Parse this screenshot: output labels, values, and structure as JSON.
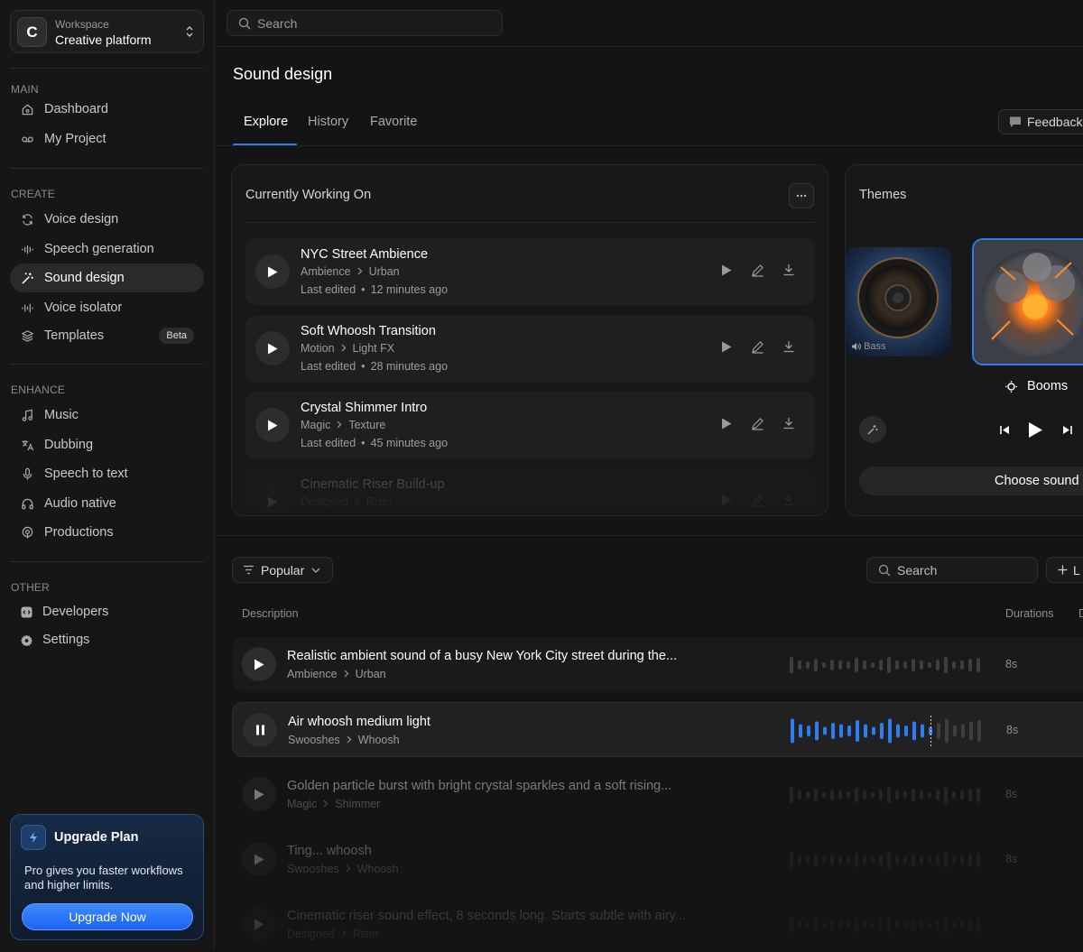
{
  "workspace": {
    "initial": "C",
    "label": "Workspace",
    "name": "Creative platform"
  },
  "sections": {
    "main": "MAIN",
    "create": "CREATE",
    "enhance": "ENHANCE",
    "other": "OTHER"
  },
  "nav": {
    "dashboard": "Dashboard",
    "my_project": "My Project",
    "voice_design": "Voice design",
    "speech_generation": "Speech generation",
    "sound_design": "Sound design",
    "voice_isolator": "Voice isolator",
    "templates": "Templates",
    "templates_badge": "Beta",
    "music": "Music",
    "dubbing": "Dubbing",
    "speech_to_text": "Speech to text",
    "audio_native": "Audio native",
    "productions": "Productions",
    "developers": "Developers",
    "settings": "Settings"
  },
  "upgrade": {
    "title": "Upgrade Plan",
    "description": "Pro gives you faster workflows and higher limits.",
    "button": "Upgrade Now"
  },
  "search": {
    "placeholder": "Search"
  },
  "page": {
    "title": "Sound design"
  },
  "tabs": [
    "Explore",
    "History",
    "Favorite"
  ],
  "active_tab": "Explore",
  "feedback": "Feedback",
  "working": {
    "title": "Currently Working On",
    "items": [
      {
        "title": "NYC Street Ambience",
        "category": "Ambience",
        "subcategory": "Urban",
        "edited_label": "Last edited",
        "edited": "12 minutes ago"
      },
      {
        "title": "Soft Whoosh Transition",
        "category": "Motion",
        "subcategory": "Light FX",
        "edited_label": "Last edited",
        "edited": "28 minutes ago"
      },
      {
        "title": "Crystal Shimmer Intro",
        "category": "Magic",
        "subcategory": "Texture",
        "edited_label": "Last edited",
        "edited": "45 minutes ago"
      },
      {
        "title": "Cinematic Riser Build-up",
        "category": "Designed",
        "subcategory": "Riser",
        "edited_label": "",
        "edited": ""
      }
    ]
  },
  "themes": {
    "title": "Themes",
    "tiles": [
      {
        "label": "Bass"
      },
      {
        "label": "Booms",
        "selected": true
      }
    ],
    "selected": "Booms",
    "choose": "Choose sound"
  },
  "library": {
    "sort": "Popular",
    "search_placeholder": "Search",
    "add_partial": "L",
    "columns": {
      "description": "Description",
      "durations": "Durations",
      "next_partial": "D"
    },
    "rows": [
      {
        "title": "Realistic ambient sound of a busy New York City street during the...",
        "category": "Ambience",
        "subcategory": "Urban",
        "duration": "8s",
        "state": "idle"
      },
      {
        "title": "Air whoosh medium light",
        "category": "Swooshes",
        "subcategory": "Whoosh",
        "duration": "8s",
        "state": "playing",
        "progress": 0.72
      },
      {
        "title": "Golden particle burst with bright crystal sparkles and a soft rising...",
        "category": "Magic",
        "subcategory": "Shimmer",
        "duration": "8s",
        "state": "idle"
      },
      {
        "title": "Ting... whoosh",
        "category": "Swooshes",
        "subcategory": "Whoosh",
        "duration": "8s",
        "state": "idle"
      },
      {
        "title": "Cinematic riser sound effect, 8 seconds long. Starts subtle with airy...",
        "category": "Designed",
        "subcategory": "Riser",
        "duration": "",
        "state": "idle"
      }
    ]
  },
  "colors": {
    "accent": "#2f7bf2",
    "background": "#141414",
    "panel": "#181818"
  }
}
